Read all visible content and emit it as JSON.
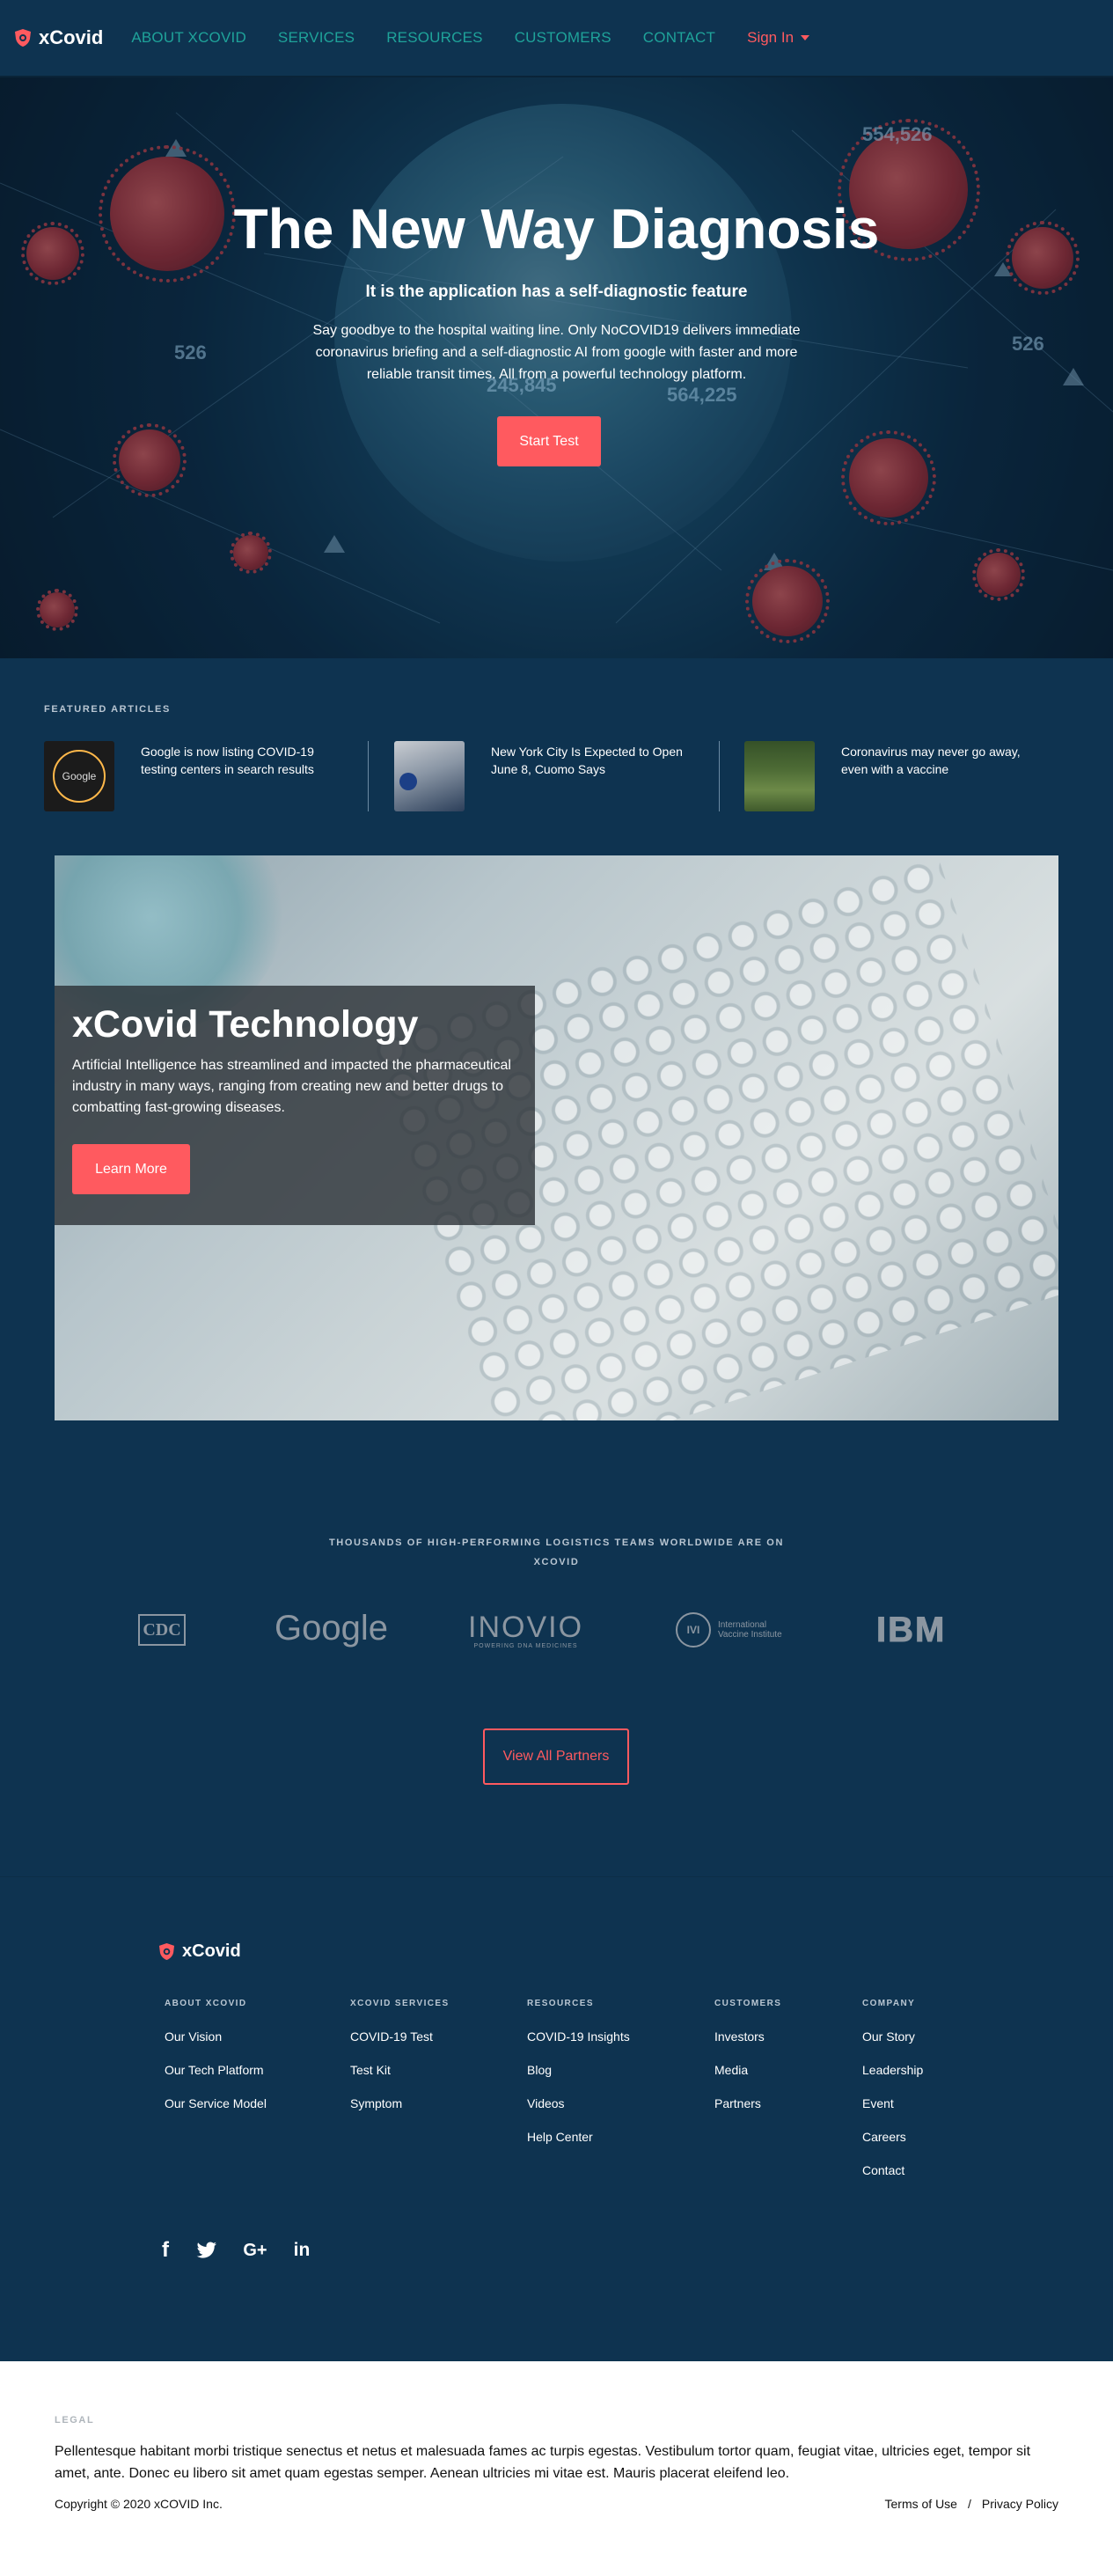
{
  "nav": {
    "brand": "xCovid",
    "links": [
      "ABOUT XCOVID",
      "SERVICES",
      "RESOURCES",
      "CUSTOMERS",
      "CONTACT"
    ],
    "signin": "Sign In"
  },
  "hero": {
    "title": "The New Way Diagnosis",
    "subtitle": "It is the application has a self-diagnostic feature",
    "description": "Say goodbye to the hospital waiting line. Only NoCOVID19 delivers immediate coronavirus briefing and a self-diagnostic AI from google with faster and more reliable transit times. All from a powerful technology platform.",
    "button": "Start Test",
    "bg_numbers": [
      "554,526",
      "526",
      "526",
      "245,845",
      "564,225"
    ]
  },
  "featured": {
    "label": "FEATURED ARTICLES",
    "articles": [
      {
        "text": "Google is now listing COVID-19 testing centers in search results",
        "thumb_label": "Google"
      },
      {
        "text": "New York City Is Expected to Open June 8, Cuomo Says"
      },
      {
        "text": "Coronavirus may never go away, even with a vaccine"
      }
    ]
  },
  "tech": {
    "title": "xCovid Technology",
    "description": "Artificial Intelligence has streamlined and impacted the pharmaceutical industry in many ways, ranging from creating new and better drugs to combatting fast-growing diseases.",
    "button": "Learn More"
  },
  "partners": {
    "label": "THOUSANDS OF HIGH-PERFORMING LOGISTICS TEAMS WORLDWIDE ARE ON XCOVID",
    "logos": [
      "CDC",
      "Google",
      "INOVIO",
      "POWERING DNA MEDICINES",
      "IVI",
      "International Vaccine Institute",
      "IBM"
    ],
    "button": "View All Partners"
  },
  "footer": {
    "brand": "xCovid",
    "columns": [
      {
        "title": "ABOUT XCOVID",
        "links": [
          "Our Vision",
          "Our Tech Platform",
          "Our Service Model"
        ]
      },
      {
        "title": "XCOVID SERVICES",
        "links": [
          "COVID-19 Test",
          "Test Kit",
          "Symptom"
        ]
      },
      {
        "title": "RESOURCES",
        "links": [
          "COVID-19 Insights",
          "Blog",
          "Videos",
          "Help Center"
        ]
      },
      {
        "title": "CUSTOMERS",
        "links": [
          "Investors",
          "Media",
          "Partners"
        ]
      },
      {
        "title": "COMPANY",
        "links": [
          "Our Story",
          "Leadership",
          "Event",
          "Careers",
          "Contact"
        ]
      }
    ],
    "social": [
      "f",
      "twitter",
      "G+",
      "in"
    ]
  },
  "legal": {
    "label": "LEGAL",
    "text": "Pellentesque habitant morbi tristique senectus et netus et malesuada fames ac turpis egestas. Vestibulum tortor quam, feugiat vitae, ultricies eget, tempor sit amet, ante. Donec eu libero sit amet quam egestas semper. Aenean ultricies mi vitae est. Mauris placerat eleifend leo.",
    "copyright": "Copyright © 2020 xCOVID Inc.",
    "terms": "Terms of Use",
    "separator": "/",
    "privacy": "Privacy Policy"
  },
  "colors": {
    "accent": "#ff5a5f",
    "teal": "#1fa39a",
    "navy": "#0e3350"
  }
}
